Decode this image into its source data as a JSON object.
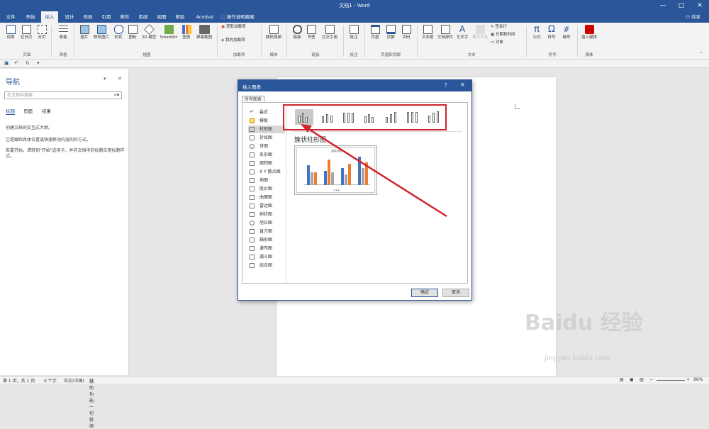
{
  "titlebar": {
    "title": "文档1 - Word",
    "min": "—",
    "max": "▢",
    "close": "✕"
  },
  "tabs": [
    {
      "label": "文件"
    },
    {
      "label": "开始"
    },
    {
      "label": "插入",
      "active": true
    },
    {
      "label": "设计"
    },
    {
      "label": "布局"
    },
    {
      "label": "引用"
    },
    {
      "label": "邮件"
    },
    {
      "label": "审阅"
    },
    {
      "label": "视图"
    },
    {
      "label": "帮助"
    },
    {
      "label": "Acrobat"
    },
    {
      "label": "操作说明搜索"
    }
  ],
  "share": "共享",
  "ribbon": {
    "buttons": [
      {
        "label": "封面"
      },
      {
        "label": "空白页"
      },
      {
        "label": "分页"
      },
      {
        "label": "表格"
      },
      {
        "label": "图片"
      },
      {
        "label": "联机图片"
      },
      {
        "label": "形状"
      },
      {
        "label": "图标"
      },
      {
        "label": "3D 模型"
      },
      {
        "label": "SmartArt"
      },
      {
        "label": "图表"
      },
      {
        "label": "屏幕截图"
      },
      {
        "label": "获取加载项"
      },
      {
        "label": "我的加载项"
      },
      {
        "label": "联机视频"
      },
      {
        "label": "链接"
      },
      {
        "label": "书签"
      },
      {
        "label": "交叉引用"
      },
      {
        "label": "批注"
      },
      {
        "label": "页眉"
      },
      {
        "label": "页脚"
      },
      {
        "label": "页码"
      },
      {
        "label": "文本框"
      },
      {
        "label": "文档部件"
      },
      {
        "label": "艺术字"
      },
      {
        "label": "首字下沉"
      },
      {
        "label": "签名行"
      },
      {
        "label": "日期和时间"
      },
      {
        "label": "对象"
      },
      {
        "label": "公式"
      },
      {
        "label": "符号"
      },
      {
        "label": "编号"
      },
      {
        "label": "插入媒体"
      }
    ],
    "groups": [
      "页面",
      "表格",
      "插图",
      "加载项",
      "媒体",
      "链接",
      "批注",
      "页眉和页脚",
      "文本",
      "符号",
      "媒体"
    ]
  },
  "navigation": {
    "title": "导航",
    "search_placeholder": "在文档中搜索",
    "tabs": [
      "标题",
      "页面",
      "结果"
    ],
    "text1": "创建文档的交互式大纲。",
    "text2": "它是跟踪具体位置或快速移动内容的好方式。",
    "text3": "若要开始，请转到\"开始\"选项卡，并向文档中的标题应用标题样式。"
  },
  "dialog": {
    "title": "插入图表",
    "help": "?",
    "close": "✕",
    "all_tab": "所有图表",
    "categories": [
      {
        "label": "最近"
      },
      {
        "label": "模板"
      },
      {
        "label": "柱形图",
        "selected": true
      },
      {
        "label": "折线图"
      },
      {
        "label": "饼图"
      },
      {
        "label": "条形图"
      },
      {
        "label": "面积图"
      },
      {
        "label": "X Y 散点图"
      },
      {
        "label": "地图"
      },
      {
        "label": "股价图"
      },
      {
        "label": "曲面图"
      },
      {
        "label": "雷达图"
      },
      {
        "label": "树状图"
      },
      {
        "label": "旭日图"
      },
      {
        "label": "直方图"
      },
      {
        "label": "箱形图"
      },
      {
        "label": "瀑布图"
      },
      {
        "label": "漏斗图"
      },
      {
        "label": "组合图"
      }
    ],
    "selected_subtype": "簇状柱形图",
    "preview_title": "图表标题",
    "ok": "确定",
    "cancel": "取消"
  },
  "status": {
    "page": "第 1 页，共 1 页",
    "words": "0 个字",
    "lang": "中文(中国)",
    "accessibility": "辅助功能: 一切就绪",
    "zoom": "96%"
  },
  "colors": {
    "accent": "#2b579a",
    "highlight": "#d0232a",
    "bar_blue": "#4472c4",
    "bar_orange": "#ed7d31",
    "bar_gray": "#a5a5a5"
  }
}
